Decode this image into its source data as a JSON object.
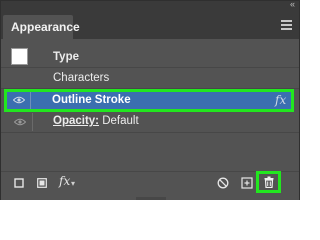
{
  "panel": {
    "tab_label": "Appearance",
    "collapse_glyph": "«",
    "menu_icon": "hamburger-menu-icon"
  },
  "rows": {
    "type_label": "Type",
    "characters_label": "Characters",
    "outline_stroke_label": "Outline Stroke",
    "opacity_label": "Opacity:",
    "opacity_value": " Default",
    "fx_glyph": "fx"
  },
  "bottom": {
    "fx_glyph": "fx"
  },
  "colors": {
    "highlight_row": "#3b6fb0",
    "callout_green": "#22e61f",
    "panel_bg": "#535353"
  }
}
